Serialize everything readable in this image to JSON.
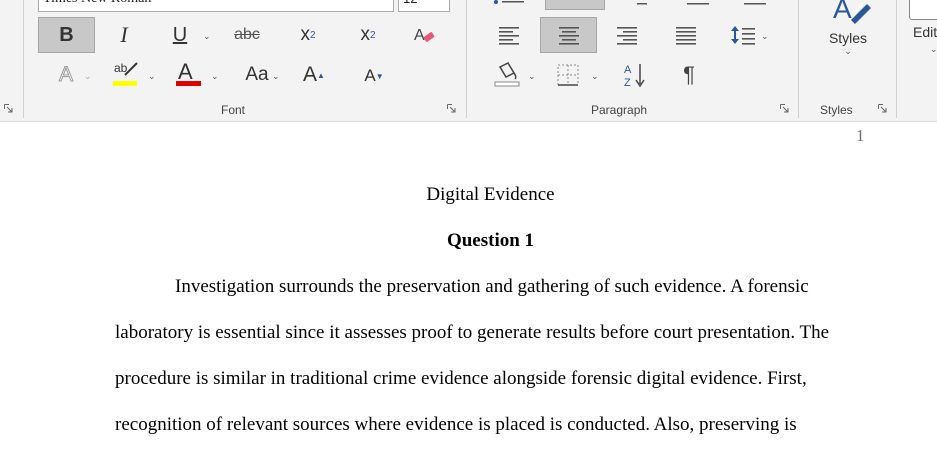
{
  "ribbon": {
    "font_name": "Times New Roman",
    "font_size": "12",
    "groups": {
      "font": "Font",
      "paragraph": "Paragraph",
      "styles": "Styles"
    },
    "styles_button_label": "Styles",
    "editing_label": "Editi",
    "buttons": {
      "bold": "B",
      "italic": "I",
      "underline": "U",
      "strikethrough": "abc",
      "subscript": "x",
      "subscript_mark": "2",
      "superscript": "x",
      "superscript_mark": "2",
      "highlight": "ab",
      "font_color": "A",
      "change_case": "Aa",
      "grow_font": "A",
      "shrink_font": "A",
      "text_effects": "A",
      "pilcrow": "¶"
    },
    "colors": {
      "highlight": "#ffff00",
      "font_color": "#e00000",
      "accent": "#2b579a"
    }
  },
  "document": {
    "page_number": "1",
    "title": "Digital Evidence",
    "heading": "Question 1",
    "lines": [
      "Investigation surrounds the preservation and gathering of such evidence. A forensic",
      "laboratory is essential since it assesses proof to generate results before court presentation. The",
      "procedure is similar in traditional crime evidence alongside forensic digital evidence. First,",
      "recognition of relevant sources where evidence is placed is conducted. Also, preserving is"
    ]
  }
}
